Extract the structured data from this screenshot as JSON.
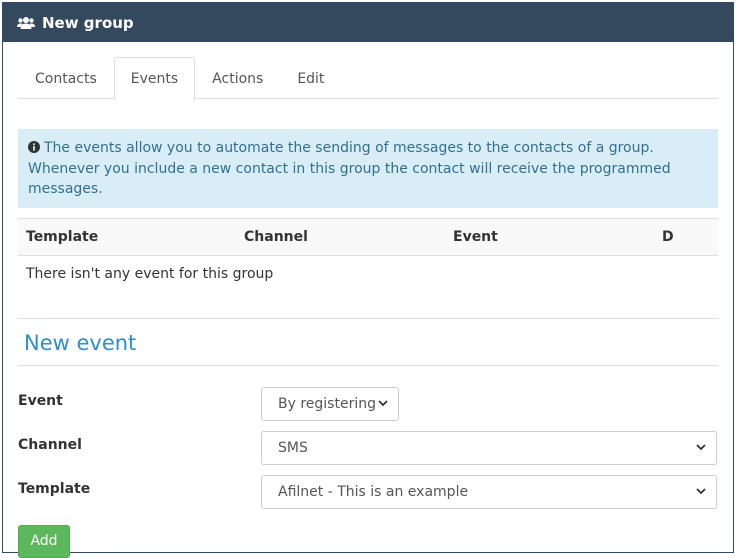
{
  "header": {
    "title": "New group",
    "icon": "users-icon"
  },
  "tabs": [
    {
      "label": "Contacts",
      "active": false
    },
    {
      "label": "Events",
      "active": true
    },
    {
      "label": "Actions",
      "active": false
    },
    {
      "label": "Edit",
      "active": false
    }
  ],
  "info": {
    "text": "The events allow you to automate the sending of messages to the contacts of a group. Whenever you include a new contact in this group the contact will receive the programmed messages.",
    "icon": "info-circle-icon"
  },
  "table": {
    "columns": [
      "Template",
      "Channel",
      "Event",
      "D"
    ],
    "empty_message": "There isn't any event for this group"
  },
  "new_event": {
    "title": "New event",
    "event_label": "Event",
    "event_value": "By registering",
    "channel_label": "Channel",
    "channel_value": "SMS",
    "template_label": "Template",
    "template_value": "Afilnet - This is an example",
    "add_label": "Add"
  },
  "colors": {
    "header_bg": "#34495e",
    "info_bg": "#d9edf7",
    "info_text": "#31708f",
    "accent_title": "#2f8ed0",
    "add_button": "#5cb85c"
  }
}
